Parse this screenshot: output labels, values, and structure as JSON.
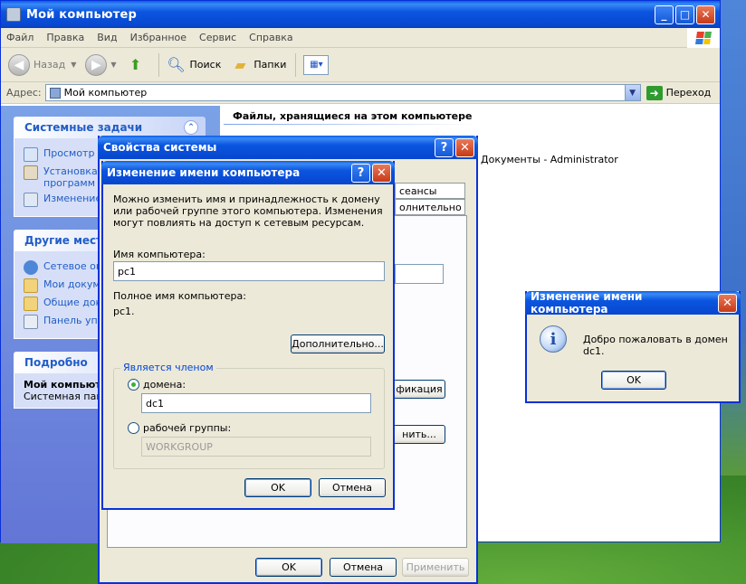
{
  "explorer": {
    "title": "Мой компьютер",
    "menu": [
      "Файл",
      "Правка",
      "Вид",
      "Избранное",
      "Сервис",
      "Справка"
    ],
    "toolbar": {
      "back": "Назад",
      "search": "Поиск",
      "folders": "Папки"
    },
    "address": {
      "label": "Адрес:",
      "value": "Мой компьютер",
      "go": "Переход"
    },
    "content_heading": "Файлы, хранящиеся на этом компьютере",
    "content_item": "Документы - Administrator",
    "tasks": {
      "system_title": "Системные задачи",
      "system_items": [
        "Просмотр с",
        "Установка",
        "программ",
        "Изменение"
      ],
      "other_title": "Другие места",
      "other_items": [
        "Сетевое ок",
        "Мои докум",
        "Общие док",
        "Панель упр"
      ],
      "details_title": "Подробно",
      "details_name": "Мой компьют",
      "details_desc": "Системная папк"
    }
  },
  "sysprops": {
    "title": "Свойства системы",
    "tab_sessions": "сеансы",
    "tab_advanced": "олнительно",
    "btn_identify": "фикация",
    "btn_change": "нить...",
    "ok": "OK",
    "cancel": "Отмена",
    "apply": "Применить"
  },
  "rename": {
    "title": "Изменение имени компьютера",
    "intro": "Можно изменить имя и принадлежность к домену или рабочей группе этого компьютера. Изменения могут повлиять на доступ к сетевым ресурсам.",
    "name_label": "Имя компьютера:",
    "name_value": "pc1",
    "fullname_label": "Полное имя компьютера:",
    "fullname_value": "pc1.",
    "more": "Дополнительно...",
    "member_group": "Является членом",
    "domain_label": "домена:",
    "domain_value": "dc1",
    "workgroup_label": "рабочей группы:",
    "workgroup_value": "WORKGROUP",
    "ok": "OK",
    "cancel": "Отмена"
  },
  "welcome": {
    "title": "Изменение имени компьютера",
    "message": "Добро пожаловать в домен dc1.",
    "ok": "OK"
  }
}
